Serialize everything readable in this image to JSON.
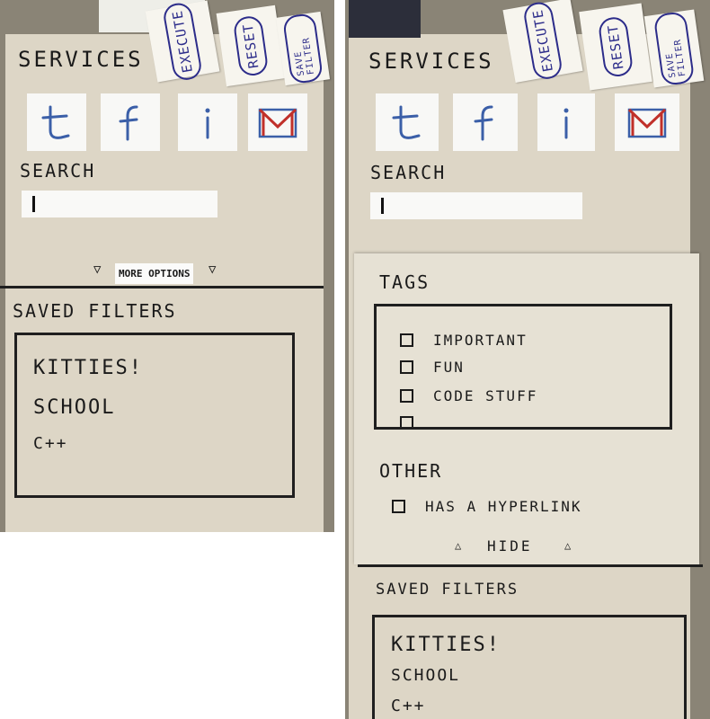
{
  "left": {
    "header": {
      "title": "SERVICES"
    },
    "sticky_notes": [
      {
        "label": "EXECUTE"
      },
      {
        "label": "RESET"
      },
      {
        "label": "SAVE FILTER"
      }
    ],
    "services": [
      {
        "icon": "twitter-icon"
      },
      {
        "icon": "facebook-icon"
      },
      {
        "icon": "info-icon"
      },
      {
        "icon": "gmail-icon"
      }
    ],
    "search": {
      "label": "SEARCH",
      "value": ""
    },
    "more_options": {
      "label": "MORE OPTIONS"
    },
    "saved_filters": {
      "label": "SAVED FILTERS",
      "items": [
        "KITTIES!",
        "SCHOOL",
        "C++"
      ]
    }
  },
  "right": {
    "header": {
      "title": "SERVICES"
    },
    "sticky_notes": [
      {
        "label": "EXECUTE"
      },
      {
        "label": "RESET"
      },
      {
        "label": "SAVE FILTER"
      }
    ],
    "search": {
      "label": "SEARCH",
      "value": ""
    },
    "tags": {
      "label": "TAGS",
      "items": [
        "IMPORTANT",
        "FUN",
        "CODE STUFF"
      ]
    },
    "other": {
      "label": "OTHER",
      "items": [
        "HAS A HYPERLINK"
      ]
    },
    "hide": {
      "label": "HIDE"
    },
    "saved_filters": {
      "label": "SAVED FILTERS",
      "items": [
        "KITTIES!",
        "SCHOOL",
        "C++"
      ]
    }
  },
  "colors": {
    "paper": "#ddd6c6",
    "ink": "#1a1a1a",
    "note_ink": "#2c2c8a",
    "gmail_red": "#c0302a",
    "icon_blue": "#3b5fa8"
  }
}
